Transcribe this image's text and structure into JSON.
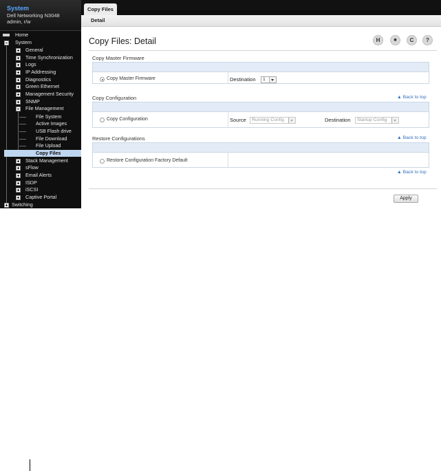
{
  "sidebar": {
    "title": "System",
    "device": "Dell Networking N3048",
    "user": "admin, r/w",
    "items": [
      {
        "label": "Home"
      },
      {
        "label": "System"
      },
      {
        "label": "General"
      },
      {
        "label": "Time Synchronization"
      },
      {
        "label": "Logs"
      },
      {
        "label": "IP Addressing"
      },
      {
        "label": "Diagnostics"
      },
      {
        "label": "Green Ethernet"
      },
      {
        "label": "Management Security"
      },
      {
        "label": "SNMP"
      },
      {
        "label": "File Management"
      },
      {
        "label": "File System"
      },
      {
        "label": "Active Images"
      },
      {
        "label": "USB Flash drive"
      },
      {
        "label": "File Download"
      },
      {
        "label": "File Upload"
      },
      {
        "label": "Copy Files"
      },
      {
        "label": "Stack Management"
      },
      {
        "label": "sFlow"
      },
      {
        "label": "Email Alerts"
      },
      {
        "label": "ISDP"
      },
      {
        "label": "iSCSI"
      },
      {
        "label": "Captive Portal"
      },
      {
        "label": "Switching"
      }
    ]
  },
  "header": {
    "tab": "Copy Files",
    "subtab": "Detail"
  },
  "page": {
    "title": "Copy Files: Detail",
    "toolbar": {
      "save_glyph": "H",
      "print_glyph": "■",
      "refresh_glyph": "C",
      "help_glyph": "?"
    }
  },
  "sections": {
    "master": {
      "title": "Copy Master Firmware",
      "radio_label": "Copy Master Firmware",
      "destination_label": "Destination",
      "destination_value": "1"
    },
    "config": {
      "title": "Copy Configuration",
      "back": "▲ Back to top",
      "radio_label": "Copy Configuration",
      "source_label": "Source",
      "source_value": "Running Config",
      "destination_label": "Destination",
      "destination_value": "Startup Config"
    },
    "restore": {
      "title": "Restore Configurations",
      "back": "▲ Back to top",
      "radio_label": "Restore Configuration Factory Default"
    },
    "bottom_back": "▲ Back to top"
  },
  "actions": {
    "apply": "Apply"
  },
  "icons": [
    "save-icon",
    "print-icon",
    "refresh-icon",
    "help-icon",
    "home-icon",
    "expand-icon",
    "collapse-icon"
  ]
}
